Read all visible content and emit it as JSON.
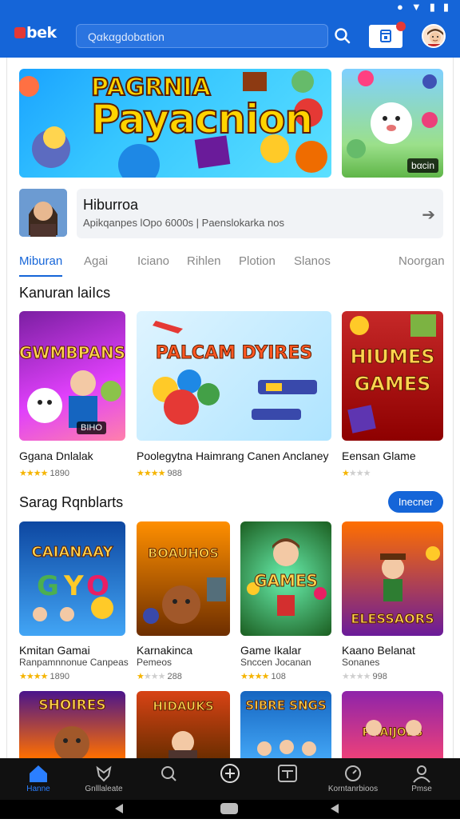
{
  "app": {
    "logo": "bek"
  },
  "search": {
    "placeholder": "Qαkαgdobαtion"
  },
  "banner": {
    "title_top": "PAGRNIA",
    "title_main": "Payacnion",
    "side_badge": "bαcin"
  },
  "profile": {
    "name": "Hiburroa",
    "subtitle": "Apikqanpes lOpo 6000s | Paenslokarka nos"
  },
  "tabs": [
    {
      "label": "Miburan",
      "active": true
    },
    {
      "label": "Agai",
      "active": false
    },
    {
      "label": "Iciano",
      "active": false
    },
    {
      "label": "Rihlen",
      "active": false
    },
    {
      "label": "Plotion",
      "active": false
    },
    {
      "label": "Slanos",
      "active": false
    },
    {
      "label": "Noorgan",
      "active": false
    }
  ],
  "section1": {
    "title": "Kanuran laiIcs",
    "cards": [
      {
        "image_text": "GWMBPANS",
        "image_badge": "BIHO",
        "title": "Ggana Dnlalak",
        "rating_stars": 4,
        "rating_text": "1890"
      },
      {
        "image_text": "PALCAM DYIRES",
        "title": "Poolegytna Haimrang Canen Anclaney",
        "rating_stars": 4,
        "rating_text": "988"
      },
      {
        "image_text": "HIUMES GAMES",
        "title": "Eensan Glame",
        "rating_stars": 1,
        "rating_text": ""
      }
    ]
  },
  "section2": {
    "title": "Sarag Rqnblarts",
    "more_label": "Inecner",
    "cards": [
      {
        "image_text": "CAIANAAY",
        "title": "Kmitan Gamai",
        "subtitle": "Ranpamnnonue Canpeas",
        "rating_stars": 4,
        "rating_text": "1890"
      },
      {
        "image_text": "BOAUHOS",
        "title": "Karnakinca",
        "subtitle": "Pemeos",
        "rating_stars": 1,
        "rating_text": "288"
      },
      {
        "image_text": "GAMES",
        "title": "Game Ikalar",
        "subtitle": "Snccen Jocanan",
        "rating_stars": 4,
        "rating_text": "108"
      },
      {
        "image_text": "ELESSAORS",
        "title": "Kaano Belanat",
        "subtitle": "Sonanes",
        "rating_stars": 0,
        "rating_text": "998"
      }
    ]
  },
  "section3": {
    "cards": [
      {
        "image_text": "SHOIRES"
      },
      {
        "image_text": "HIDAUKS"
      },
      {
        "image_text": "SIBRE SNGS"
      },
      {
        "image_text": "PHAIJOBS"
      }
    ]
  },
  "bottom_nav": [
    {
      "label": "Hanne",
      "icon": "home-icon",
      "active": true
    },
    {
      "label": "Gnlllaleate",
      "icon": "puzzle-icon",
      "active": false
    },
    {
      "label": "",
      "icon": "search-icon",
      "active": false
    },
    {
      "label": "",
      "icon": "add-circle-icon",
      "active": false
    },
    {
      "label": "",
      "icon": "collections-icon",
      "active": false
    },
    {
      "label": "Korntanrbioos",
      "icon": "timer-icon",
      "active": false
    },
    {
      "label": "Pmse",
      "icon": "profile-icon",
      "active": false
    }
  ],
  "colors": {
    "primary": "#1565d8",
    "star": "#f5b400",
    "nav_bg": "#111111"
  }
}
